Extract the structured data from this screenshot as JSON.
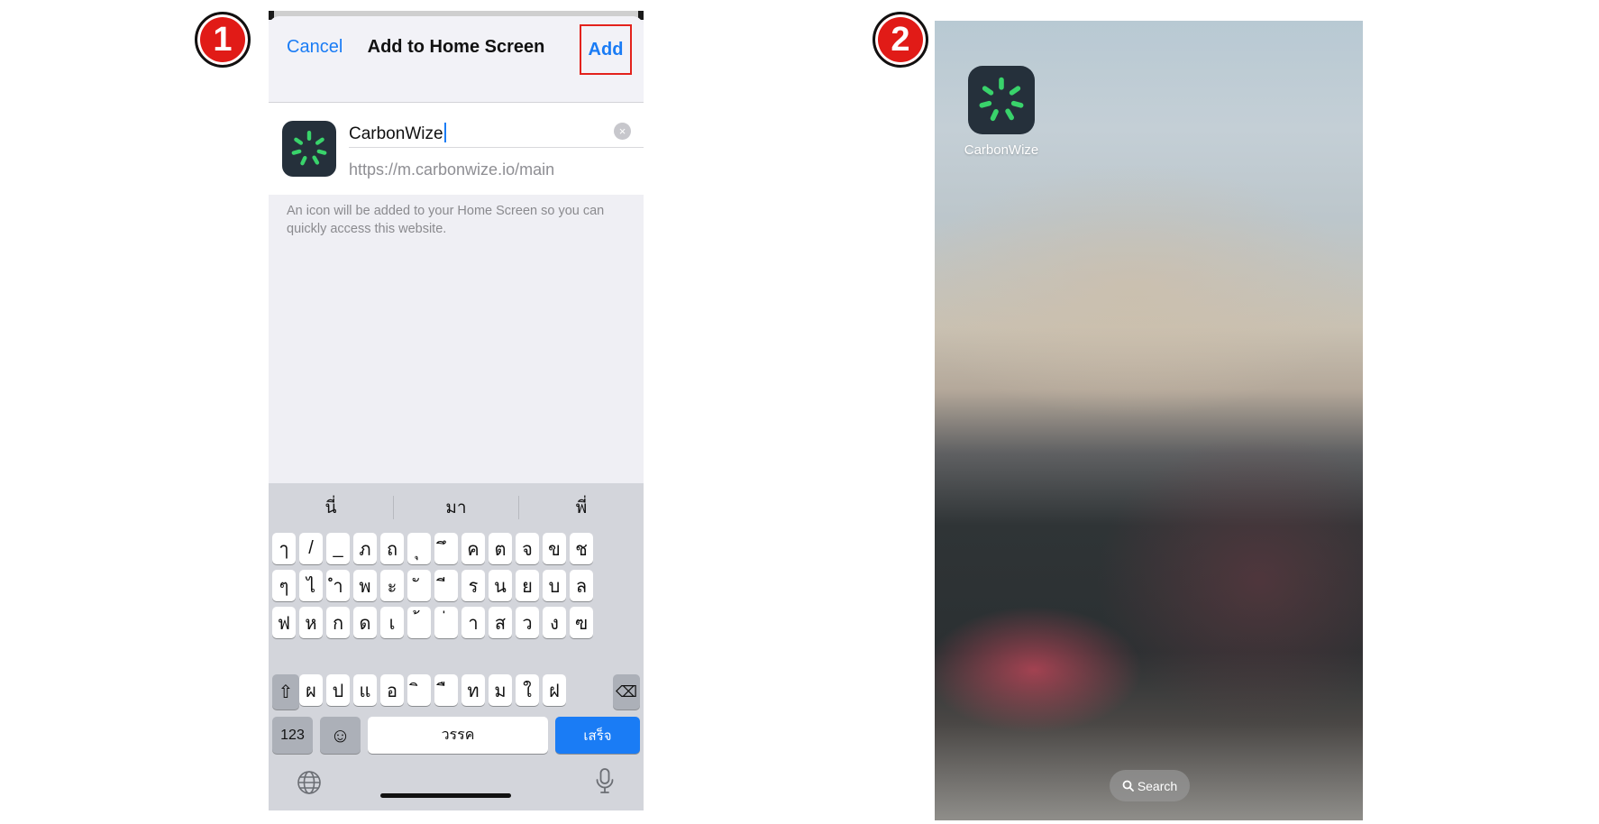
{
  "steps": {
    "first": "1",
    "second": "2"
  },
  "add_sheet": {
    "cancel_label": "Cancel",
    "title": "Add to Home Screen",
    "add_label": "Add",
    "name_value": "CarbonWize",
    "clear_symbol": "×",
    "url_value": "https://m.carbonwize.io/main",
    "info_text": "An icon will be added to your Home Screen so you can quickly access this website."
  },
  "keyboard": {
    "suggestions": [
      "นี่",
      "มา",
      "พี่"
    ],
    "row1": [
      "ๅ",
      "/",
      "_",
      "ภ",
      "ถ",
      "ุ",
      "ึ",
      "ค",
      "ต",
      "จ",
      "ข",
      "ช"
    ],
    "row2": [
      "ๆ",
      "ไ",
      "ำ",
      "พ",
      "ะ",
      "ั",
      "ี",
      "ร",
      "น",
      "ย",
      "บ",
      "ล"
    ],
    "row3": [
      "ฟ",
      "ห",
      "ก",
      "ด",
      "เ",
      "้",
      "่",
      "า",
      "ส",
      "ว",
      "ง",
      "ฃ"
    ],
    "row4": [
      "ผ",
      "ป",
      "แ",
      "อ",
      "ิ",
      "ื",
      "ท",
      "ม",
      "ใ",
      "ฝ"
    ],
    "shift_symbol": "⇧",
    "delete_symbol": "⌫",
    "numbers_label": "123",
    "emoji_symbol": "☺",
    "space_label": "วรรค",
    "done_label": "เสร็จ",
    "globe_icon": "globe-icon",
    "mic_icon": "microphone-icon"
  },
  "home_screen": {
    "app_label": "CarbonWize",
    "search_label": "Search"
  },
  "colors": {
    "ios_blue": "#1a7cf5",
    "highlight_red": "#e3221c",
    "badge_red": "#e11b17",
    "icon_bg": "#25303b",
    "icon_green": "#39d36b"
  }
}
